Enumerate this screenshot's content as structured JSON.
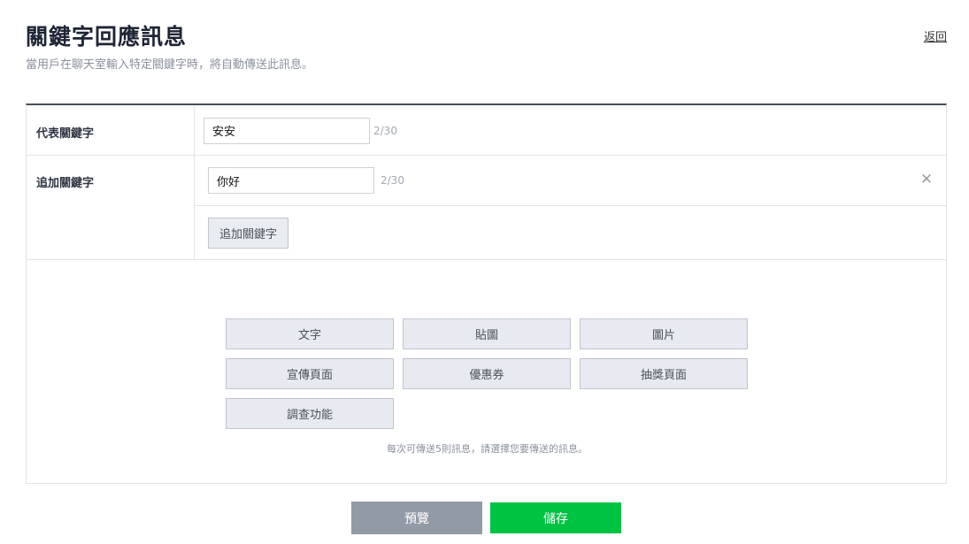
{
  "header": {
    "title": "關鍵字回應訊息",
    "subtitle": "當用戶在聊天室輸入特定關鍵字時，將自動傳送此訊息。",
    "back_label": "返回"
  },
  "primary_keyword": {
    "label": "代表關鍵字",
    "value": "安安",
    "counter": "2/30"
  },
  "additional_keywords": {
    "label": "追加關鍵字",
    "items": [
      {
        "value": "你好",
        "counter": "2/30",
        "remove_icon": "close-icon"
      }
    ],
    "add_button_label": "追加關鍵字"
  },
  "message_types": {
    "buttons": [
      "文字",
      "貼圖",
      "圖片",
      "宣傳頁面",
      "優惠券",
      "抽獎頁面",
      "調查功能"
    ],
    "hint": "每次可傳送5則訊息，請選擇您要傳送的訊息。"
  },
  "footer": {
    "preview_label": "預覽",
    "save_label": "儲存"
  },
  "colors": {
    "save_button": "#00c243",
    "preview_button": "#929aa5",
    "table_top_border": "#474e5c"
  }
}
